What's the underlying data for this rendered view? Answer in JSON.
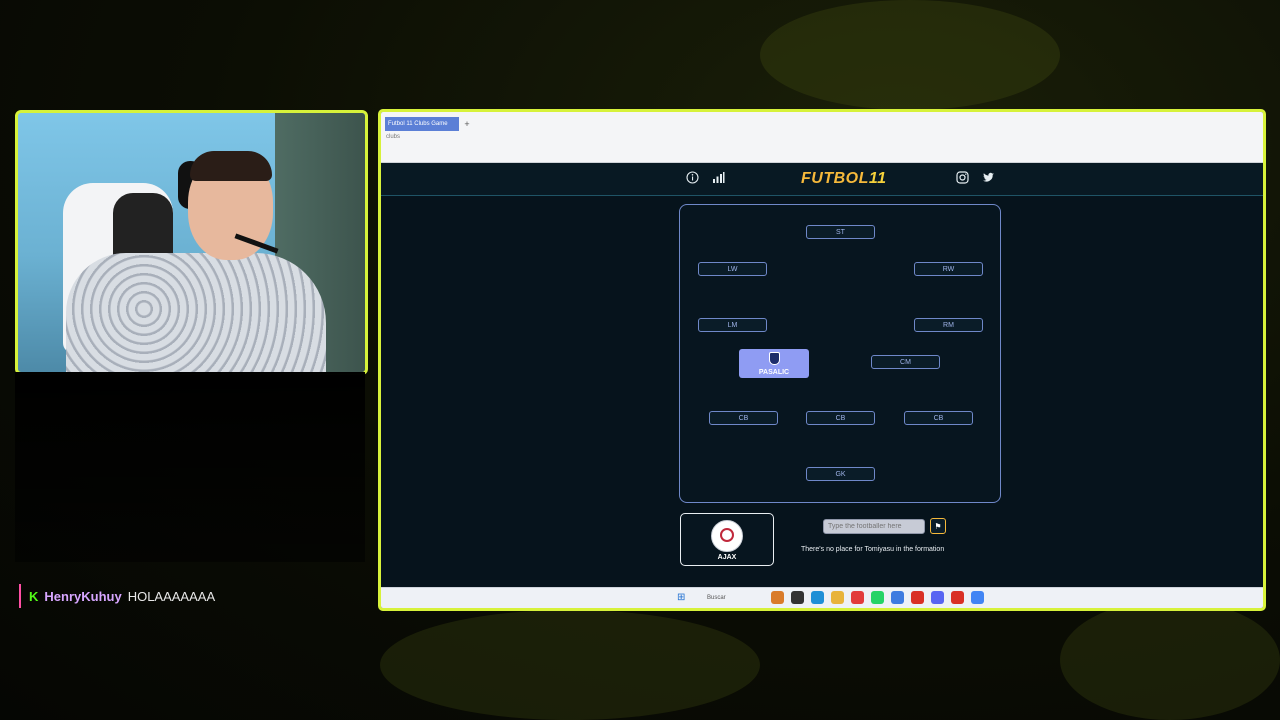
{
  "chat": {
    "badge": "K",
    "username": "HenryKuhuy",
    "message": "HOLAAAAAAA"
  },
  "browser": {
    "tab_title": "Futbol 11 Clubs Game",
    "new_tab": "+",
    "url_text": "clubs"
  },
  "site": {
    "logo_main": "FUTBOL",
    "logo_accent": "11",
    "icons": [
      "info-icon",
      "stats-icon",
      "instagram-icon",
      "twitter-icon"
    ]
  },
  "formation": {
    "positions": [
      "ST",
      "LW",
      "RW",
      "LM",
      "RM",
      "CM",
      "CB",
      "CB",
      "CB",
      "GK"
    ],
    "filled_player": "PASALIC"
  },
  "club": {
    "name": "AJAX"
  },
  "guess": {
    "placeholder": "Type the footballer here",
    "message": "There's no place for Tomiyasu in the formation"
  },
  "taskbar": {
    "search_label": "Buscar",
    "app_colors": [
      "#d97b2a",
      "#333333",
      "#1f8fd6",
      "#e8b33a",
      "#e23b3b",
      "#25d366",
      "#3e7be0",
      "#d93025",
      "#5865f2",
      "#d93025",
      "#4285f4"
    ]
  },
  "colors": {
    "frame_accent": "#d7f23a",
    "logo": "#f6b93b",
    "filled_card": "#8f9cf3"
  }
}
